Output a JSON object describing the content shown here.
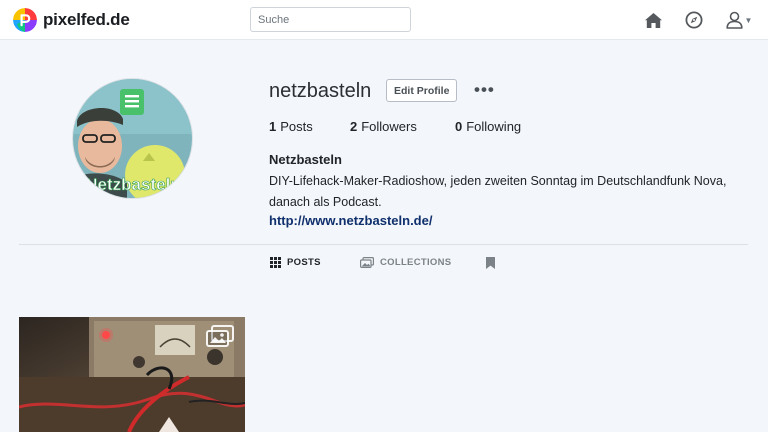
{
  "nav": {
    "brand": "pixelfed.de",
    "search_placeholder": "Suche",
    "icons": [
      "home-icon",
      "explore-compass-icon",
      "user-menu-icon"
    ]
  },
  "profile": {
    "username": "netzbasteln",
    "edit_label": "Edit Profile",
    "more_label": "•••",
    "stats": {
      "posts_count": "1",
      "posts_label": "Posts",
      "followers_count": "2",
      "followers_label": "Followers",
      "following_count": "0",
      "following_label": "Following"
    },
    "display_name": "Netzbasteln",
    "bio": "DIY-Lifehack-Maker-Radioshow, jeden zweiten Sonntag im Deutschlandfunk Nova, danach als Podcast.",
    "website": "http://www.netzbasteln.de/",
    "avatar_text": "Netzbasteln"
  },
  "tabs": {
    "posts": "POSTS",
    "collections": "COLLECTIONS",
    "saved_icon": "bookmark-icon"
  },
  "colors": {
    "accent_link": "#10306d",
    "background": "#f3f6fa",
    "brand_gradient": [
      "#f9c300",
      "#ff3b3b",
      "#8b3dff",
      "#1fa4ff",
      "#0ecf6b"
    ]
  }
}
